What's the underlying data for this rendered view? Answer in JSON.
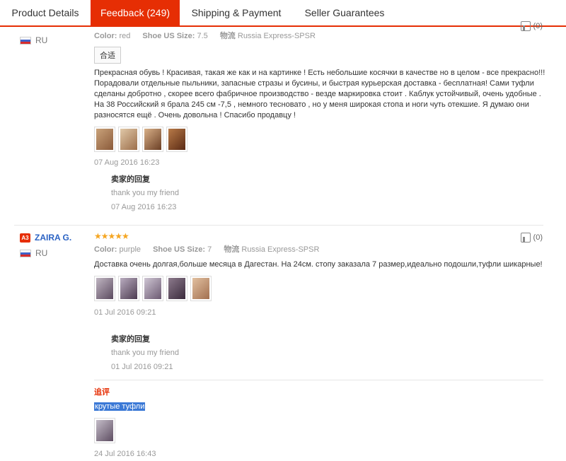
{
  "tabs": [
    {
      "label": "Product Details"
    },
    {
      "label": "Feedback (249)"
    },
    {
      "label": "Shipping & Payment"
    },
    {
      "label": "Seller Guarantees"
    }
  ],
  "reviews": [
    {
      "user": "",
      "country": "RU",
      "stars": "★★★★★",
      "color_label": "Color:",
      "color": "red",
      "size_label": "Shoe US Size:",
      "size": "7.5",
      "ship_label": "物流",
      "ship": "Russia Express-SPSR",
      "tag": "合适",
      "text": "Прекрасная обувь ! Красивая, такая же как и на картинке ! Есть небольшие косячки в качестве но в целом - все прекрасно!!! Порадовали отдельные пыльники, запасные стразы и бусины, и быстрая курьерская доставка - бесплатная! Сами туфли сделаны добротно , скорее всего фабричное производство - везде маркировка стоит . Каблук устойчивый, очень удобные . На 38 Российский я брала 245 см -7,5 , немного тесновато , но у меня широкая стопа и ноги чуть отекшие. Я думаю они разносятся ещё . Очень довольна ! Спасибо продавцу !",
      "date": "07 Aug 2016 16:23",
      "reply_title": "卖家的回复",
      "reply_text": "thank you my friend",
      "reply_date": "07 Aug 2016 16:23",
      "helpful": "(0)"
    },
    {
      "level": "A3",
      "user": "ZAIRA G.",
      "country": "RU",
      "stars": "★★★★★",
      "color_label": "Color:",
      "color": "purple",
      "size_label": "Shoe US Size:",
      "size": "7",
      "ship_label": "物流",
      "ship": "Russia Express-SPSR",
      "text": "Доставка очень долгая,больше месяца в Дагестан. На 24см. стопу заказала 7 размер,идеально подошли,туфли шикарные!",
      "date": "01 Jul 2016 09:21",
      "reply_title": "卖家的回复",
      "reply_text": "thank you my friend",
      "reply_date": "01 Jul 2016 09:21",
      "additional_label": "追评",
      "additional_text": "крутые туфли",
      "additional_date": "24 Jul 2016 16:43",
      "helpful": "(0)"
    }
  ],
  "colors": {
    "accent": "#e62e04",
    "link": "#2b63c4",
    "star": "#f5a623"
  },
  "icons": {
    "like": "thumbs-up-icon",
    "flag": "russia-flag-icon"
  }
}
